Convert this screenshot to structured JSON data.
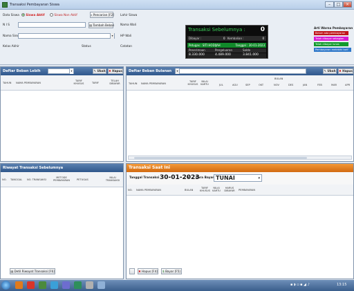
{
  "window": {
    "title": "Transaksi Pembayaran Siswa"
  },
  "form": {
    "data_siswa": "Data Siswa",
    "radio_aktif": "Siswa Aktif",
    "radio_non": "Siswa Non Aktif",
    "pencarian": "Pencarian [F2]",
    "nis": "N I S",
    "tambah_beban": "Tambah Beban",
    "nama_siswa": "Nama Siswa",
    "kelas_akhir": "Kelas Akhir",
    "status": "Status",
    "lahir": "Lahir Siswa",
    "nama_wali": "Nama Wali",
    "hp_wali": "HP Wali",
    "catatan": "Catatan"
  },
  "summary": {
    "title": "Transaksi Sebelumnya :",
    "count": "0",
    "dibayar_label": "Dibayar :",
    "dibayar_value": "0",
    "kembalian_label": "Kembalian :",
    "kembalian_value": "0",
    "petugas": "Petugas : SITI HODIJAH",
    "tanggal": "Tanggal : 30-01-2023",
    "col1": "Penerimaan",
    "col2": "Pengeluaran",
    "col3": "Saldo",
    "v1": "8.330.000",
    "v2": "4.489.000",
    "v3": "3.841.000"
  },
  "legend": {
    "title": "Arti Warna Pembayaran :",
    "items": [
      {
        "label": "Belum ada pembayaran",
        "color": "#c0151b"
      },
      {
        "label": "Telah dibayar sebagian",
        "color": "#d81ad1"
      },
      {
        "label": "Telah dibayar lunas",
        "color": "#119a2c"
      },
      {
        "label": "Pembayaran melebihi tarif",
        "color": "#2f78c9"
      }
    ]
  },
  "beban_lebih": {
    "title": "Daftar Beban Lebih",
    "ubah": "Ubah",
    "hapus": "Hapus",
    "columns": [
      "TAHUN",
      "NAMA PEMBAYARAN",
      "TARIF KHUSUS",
      "TARIF",
      "TELAH DIBAYAR"
    ]
  },
  "beban_bulanan": {
    "title": "Daftar Beban Bulanan",
    "ubah": "Ubah",
    "hapus": "Hapus",
    "columns": [
      "TAHUN",
      "NAMA PEMBAYARAN",
      "TARIF KHUSUS",
      "NILAI KARTU"
    ],
    "bulan_label": "BULAN",
    "months": [
      "JUL",
      "AGU",
      "SEP",
      "OKT",
      "NOV",
      "DES",
      "JAN",
      "FEB",
      "MAR",
      "APR"
    ]
  },
  "riwayat": {
    "title": "Riwayat Transaksi Sebelumnya",
    "columns": [
      "NO.",
      "TANGGAL",
      "NO. TRANSAKSI",
      "METODE PEMBAYARAN",
      "PETUGAS",
      "NILAI TRANSAKSI"
    ],
    "button": "Detil Riwayat Transaksi [F6]"
  },
  "transaksi": {
    "title": "Transaksi Saat Ini",
    "tanggal_label": "Tanggal Transaksi",
    "tanggal_value": "30-01-2023",
    "cara_label": "Cara Bayar",
    "cara_value": "TUNAI",
    "columns": [
      "NO.",
      "NAMA PEMBAYARAN",
      "BULAN",
      "TARIF KHUSUS",
      "NILAI KARTU",
      "HARUS DIBAYAR",
      "PEMBAYARAN"
    ],
    "hapus": "Hapus [F4]",
    "bayar": "Bayar [F5]"
  },
  "taskbar": {
    "clock": "13:15"
  }
}
